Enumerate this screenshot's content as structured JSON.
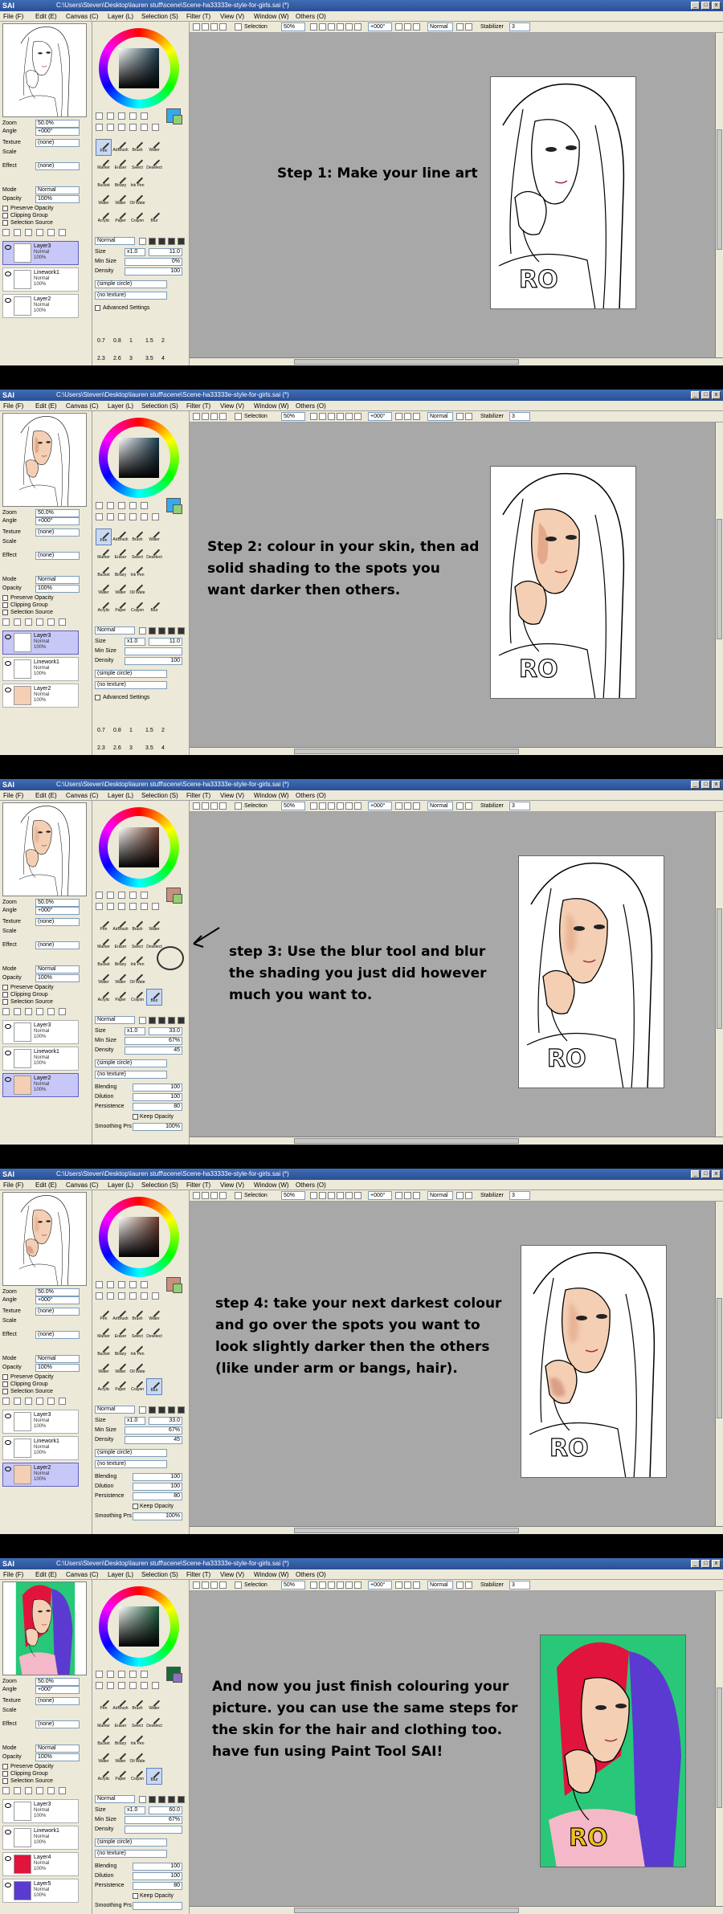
{
  "app": {
    "logo": "SAI",
    "path": "C:\\Users\\Steven\\Desktop\\lauren stuff\\scene\\Scene-ha33333e-style-for-girls.sai (*)",
    "menus": [
      "File (F)",
      "Edit (E)",
      "Canvas (C)",
      "Layer (L)",
      "Selection (S)",
      "Filter (T)",
      "View (V)",
      "Window (W)",
      "Others (O)"
    ],
    "window_buttons": [
      "_",
      "□",
      "x"
    ]
  },
  "toolbar": {
    "selection_label": "Selection",
    "zoom": "50%",
    "angle": "+000°",
    "blend": "Normal",
    "stabilizer_label": "Stabilizer",
    "stabilizer": "3"
  },
  "left_panel": {
    "zoom_label": "Zoom",
    "zoom_value": "50.0%",
    "angle_label": "Angle",
    "angle_value": "+000°",
    "texture_label": "Texture",
    "texture_value": "(none)",
    "scale_label": "Scale",
    "effect_label": "Effect",
    "effect_value": "(none)",
    "mode_label": "Mode",
    "mode_value": "Normal",
    "opacity_label": "Opacity",
    "opacity_value": "100%",
    "preserve_opacity": "Preserve Opacity",
    "clipping_group": "Clipping Group",
    "selection_source": "Selection Source"
  },
  "tools": [
    "Pen",
    "AirBrush",
    "Brush",
    "Water",
    "Marker",
    "Eraser",
    "Select",
    "Deselect",
    "Bucket",
    "Binary",
    "Ink Pen",
    "",
    "Water",
    "Water",
    "Oil Wate",
    "",
    "Acrylic",
    "Paper",
    "Crayon",
    "Blur"
  ],
  "brush_settings": {
    "mode": "Normal",
    "size_label": "Size",
    "size_mult": "x1.0",
    "min_size_label": "Min Size",
    "density_label": "Density",
    "shape": "(simple circle)",
    "texture": "(no texture)",
    "advanced": "Advanced Settings",
    "blending_label": "Blending",
    "dilution_label": "Dilution",
    "persistence_label": "Persistence",
    "keep_opacity": "Keep Opacity",
    "smoothing_label": "Smoothing Prs",
    "presets_row1": [
      "0.7",
      "0.8",
      "1",
      "1.5",
      "2"
    ],
    "presets_row2": [
      "2.3",
      "2.6",
      "3",
      "3.5",
      "4"
    ]
  },
  "steps": [
    {
      "caption": "Step 1: Make your line art",
      "size": "11.0",
      "min_size": "0%",
      "density": "100",
      "tool": "Pen",
      "stage": "lineart",
      "layers": [
        {
          "name": "Layer3",
          "mode": "Normal",
          "opacity": "100%",
          "selected": true
        },
        {
          "name": "Linework1",
          "mode": "Normal",
          "opacity": "100%",
          "selected": false
        },
        {
          "name": "Layer2",
          "mode": "Normal",
          "opacity": "100%",
          "selected": false
        }
      ],
      "color_hex": "#1a3a4a",
      "swatch_hex": "#33aaee"
    },
    {
      "caption": "Step 2: colour in your skin, then ad solid shading to the spots you want darker then others.",
      "size": "11.0",
      "min_size": "",
      "density": "100",
      "tool": "Pen",
      "stage": "solid",
      "layers": [
        {
          "name": "Layer3",
          "mode": "Normal",
          "opacity": "100%",
          "selected": true
        },
        {
          "name": "Linework1",
          "mode": "Normal",
          "opacity": "100%",
          "selected": false
        },
        {
          "name": "Layer2",
          "mode": "Normal",
          "opacity": "100%",
          "selected": false
        }
      ],
      "color_hex": "#1a3a4a",
      "swatch_hex": "#33aaee"
    },
    {
      "caption": "step 3: Use the blur tool and blur the shading you just did however much you want to.",
      "size": "33.0",
      "min_size": "67%",
      "density": "45",
      "blending": "100",
      "dilution": "100",
      "persistence": "80",
      "smoothing": "100%",
      "tool": "Blur",
      "stage": "blur",
      "layers": [
        {
          "name": "Layer3",
          "mode": "Normal",
          "opacity": "100%",
          "selected": false
        },
        {
          "name": "Linework1",
          "mode": "Normal",
          "opacity": "100%",
          "selected": false
        },
        {
          "name": "Layer2",
          "mode": "Normal",
          "opacity": "100%",
          "selected": true
        }
      ],
      "color_hex": "#6a3a2a",
      "swatch_hex": "#c8907a"
    },
    {
      "caption": "step 4: take your next darkest colour and go over the spots you want to look slightly darker then the others (like under arm or bangs, hair).",
      "size": "33.0",
      "min_size": "67%",
      "density": "45",
      "blending": "100",
      "dilution": "100",
      "persistence": "80",
      "smoothing": "100%",
      "tool": "Blur",
      "stage": "darker",
      "layers": [
        {
          "name": "Layer3",
          "mode": "Normal",
          "opacity": "100%",
          "selected": false
        },
        {
          "name": "Linework1",
          "mode": "Normal",
          "opacity": "100%",
          "selected": false
        },
        {
          "name": "Layer2",
          "mode": "Normal",
          "opacity": "100%",
          "selected": true
        }
      ],
      "color_hex": "#6a3a2a",
      "swatch_hex": "#c8907a"
    },
    {
      "caption": "And now you just finish colouring your picture. you can use the same steps for the skin for the hair and clothing too. have fun using Paint Tool SAI!",
      "size": "60.0",
      "min_size": "67%",
      "density": "",
      "blending": "100",
      "dilution": "100",
      "persistence": "80",
      "smoothing": "",
      "tool": "Blur",
      "stage": "final",
      "layers": [
        {
          "name": "Layer3",
          "mode": "Normal",
          "opacity": "100%",
          "selected": false
        },
        {
          "name": "Linework1",
          "mode": "Normal",
          "opacity": "100%",
          "selected": false
        },
        {
          "name": "Layer4",
          "mode": "Normal",
          "opacity": "100%",
          "selected": false
        },
        {
          "name": "Layer5",
          "mode": "Normal",
          "opacity": "100%",
          "selected": false
        }
      ],
      "color_hex": "#1a5a3a",
      "swatch_hex": "#1a6a3a"
    }
  ],
  "colors": {
    "skin": "#f4cfb4",
    "skin_shade": "#e3a98a",
    "hair_red": "#e0143c",
    "hair_blue": "#5a3ad0",
    "shirt_pink": "#f4b8c8",
    "bg_green": "#28c878"
  }
}
